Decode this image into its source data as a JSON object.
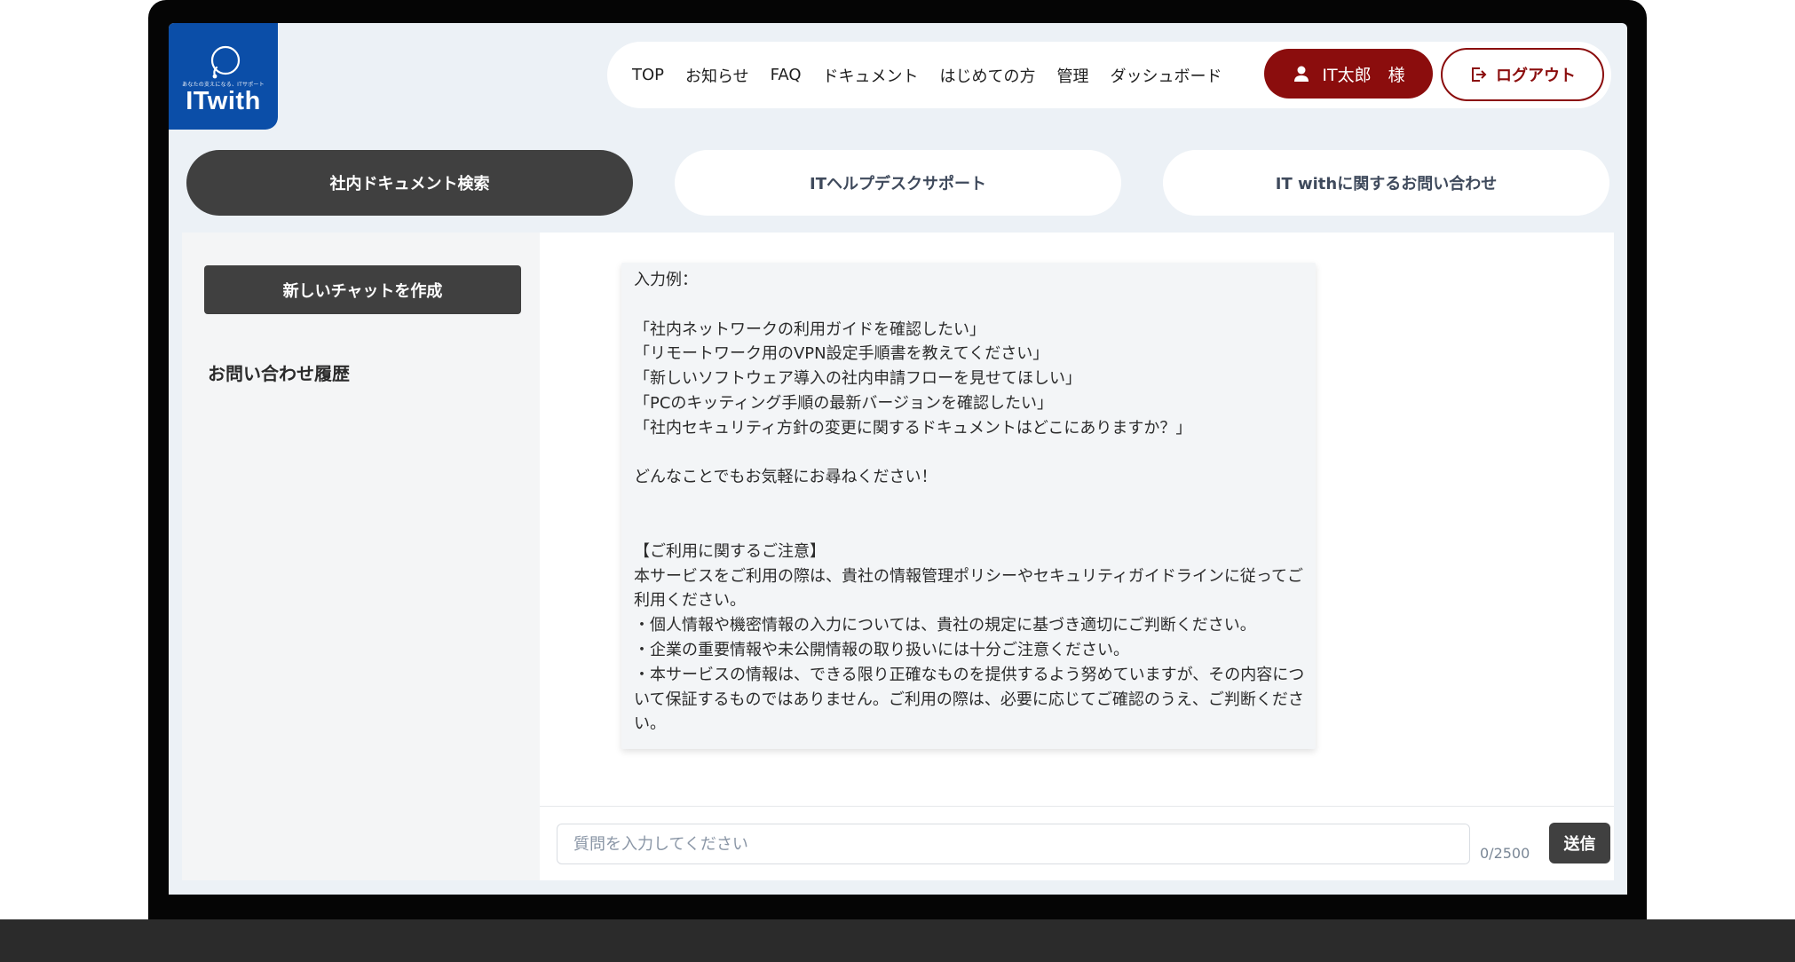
{
  "logo": {
    "tagline": "あなたの支えになる、ITサポート",
    "name": "ITwith",
    "icon": "headset-logo-icon"
  },
  "nav": {
    "links": [
      "TOP",
      "お知らせ",
      "FAQ",
      "ドキュメント",
      "はじめての方",
      "管理",
      "ダッシュボード"
    ],
    "user_label": "IT太郎　様",
    "logout_label": "ログアウト"
  },
  "tabs": [
    {
      "label": "社内ドキュメント検索",
      "active": true
    },
    {
      "label": "ITヘルプデスクサポート",
      "active": false
    },
    {
      "label": "IT withに関するお問い合わせ",
      "active": false
    }
  ],
  "sidebar": {
    "new_chat_label": "新しいチャットを作成",
    "history_title": "お問い合わせ履歴"
  },
  "message": {
    "text": "入力例：\n\n「社内ネットワークの利用ガイドを確認したい」\n「リモートワーク用のVPN設定手順書を教えてください」\n「新しいソフトウェア導入の社内申請フローを見せてほしい」\n「PCのキッティング手順の最新バージョンを確認したい」\n「社内セキュリティ方針の変更に関するドキュメントはどこにありますか？」\n\nどんなことでもお気軽にお尋ねください！\n\n\n【ご利用に関するご注意】\n本サービスをご利用の際は、貴社の情報管理ポリシーやセキュリティガイドラインに従ってご利用ください。\n・個人情報や機密情報の入力については、貴社の規定に基づき適切にご判断ください。\n・企業の重要情報や未公開情報の取り扱いには十分ご注意ください。\n・本サービスの情報は、できる限り正確なものを提供するよう努めていますが、その内容について保証するものではありません。ご利用の際は、必要に応じてご確認のうえ、ご判断ください。"
  },
  "input": {
    "placeholder": "質問を入力してください",
    "value": "",
    "counter": "0/2500",
    "send_label": "送信"
  },
  "colors": {
    "brand_blue": "#0b4ea8",
    "accent_red": "#8b0d0d",
    "dark_button": "#404040",
    "background": "#ecf1f6"
  }
}
